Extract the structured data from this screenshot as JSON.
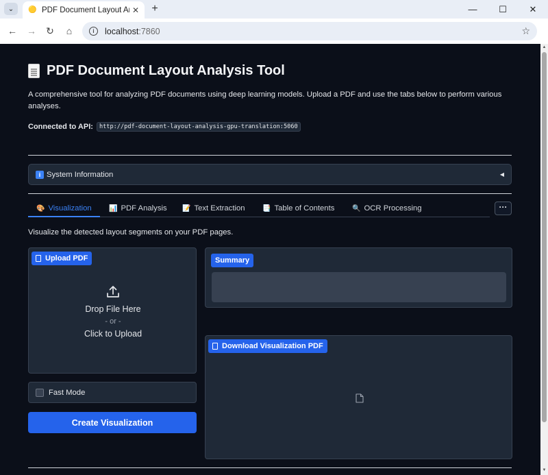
{
  "browser": {
    "tab_title": "PDF Document Layout Anal",
    "url_host": "localhost",
    "url_port": ":7860"
  },
  "page": {
    "title": "PDF Document Layout Analysis Tool",
    "description": "A comprehensive tool for analyzing PDF documents using deep learning models. Upload a PDF and use the tabs below to perform various analyses.",
    "api_label": "Connected to API:",
    "api_url": "http://pdf-document-layout-analysis-gpu-translation:5060"
  },
  "system_info": {
    "label": "System Information"
  },
  "tabs": [
    {
      "label": "Visualization",
      "icon": "🎨",
      "active": true
    },
    {
      "label": "PDF Analysis",
      "icon": "📊",
      "active": false
    },
    {
      "label": "Text Extraction",
      "icon": "📝",
      "active": false
    },
    {
      "label": "Table of Contents",
      "icon": "📑",
      "active": false
    },
    {
      "label": "OCR Processing",
      "icon": "🔍",
      "active": false
    }
  ],
  "more_button": "···",
  "visualization": {
    "description": "Visualize the detected layout segments on your PDF pages.",
    "upload_label": "Upload PDF",
    "drop_text": "Drop File Here",
    "or_text": "- or -",
    "click_text": "Click to Upload",
    "fast_mode_label": "Fast Mode",
    "create_button": "Create Visualization",
    "summary_label": "Summary",
    "download_label": "Download Visualization PDF"
  }
}
